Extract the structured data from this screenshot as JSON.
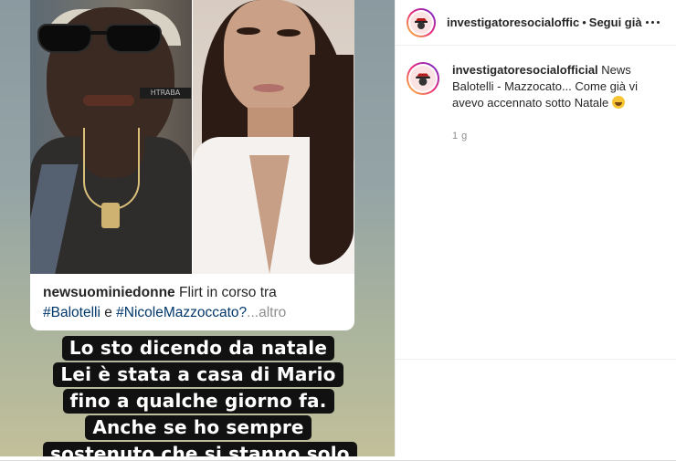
{
  "post": {
    "username": "investigatoresocialofficial",
    "header_username": "investigatoresocialoffic",
    "follow_label": "Segui già",
    "separator": "•",
    "caption": "News Balotelli - Mazzocato... Come già vi avevo accennato sotto Natale",
    "timestamp": "1 g",
    "emoji": "grinning-face"
  },
  "story": {
    "embedded_caption": {
      "username": "newsuominiedonne",
      "text": "Flirt in corso tra",
      "tag1": "#Balotelli",
      "connector": "e",
      "tag2": "#NicoleMazzoccato?",
      "more": "...altro"
    },
    "overlay_lines": [
      "Lo sto dicendo da natale",
      "Lei è stata a casa di Mario",
      "fino a qualche giorno fa.",
      "Anche se ho sempre",
      "sostenuto che si stanno solo"
    ],
    "tshirt_text": "HTRABA"
  },
  "colors": {
    "accent_link": "#00376b",
    "text_primary": "#262626",
    "text_secondary": "#8e8e8e"
  }
}
